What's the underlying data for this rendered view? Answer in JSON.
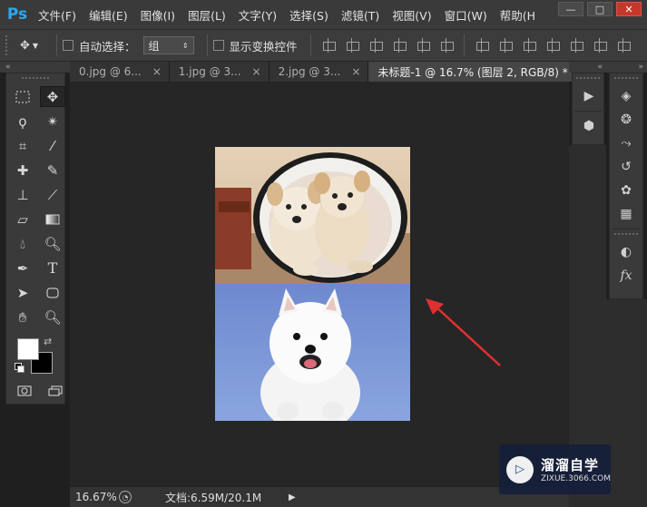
{
  "app": {
    "logo": "Ps"
  },
  "menu": [
    "文件(F)",
    "编辑(E)",
    "图像(I)",
    "图层(L)",
    "文字(Y)",
    "选择(S)",
    "滤镜(T)",
    "视图(V)",
    "窗口(W)",
    "帮助(H"
  ],
  "window_controls": {
    "minimize": "—",
    "maximize": "□",
    "close": "✕"
  },
  "options": {
    "auto_select_label": "自动选择：",
    "auto_select_value": "组",
    "show_transform_label": "显示变换控件"
  },
  "tabs": [
    {
      "label": "0.jpg @ 6...",
      "close": "×"
    },
    {
      "label": "1.jpg @ 3...",
      "close": "×"
    },
    {
      "label": "2.jpg @ 3...",
      "close": "×"
    },
    {
      "label": "未标题-1 @ 16.7% (图层 2, RGB/8) *",
      "close": "×"
    }
  ],
  "colors": {
    "foreground": "#ffffff",
    "background": "#000000",
    "accent_logo": "#2da8f0",
    "arrow": "#e03030"
  },
  "status": {
    "zoom": "16.67%",
    "doc_size": "文档:6.59M/20.1M"
  },
  "watermark": {
    "logo_text": "▷",
    "title": "溜溜自学",
    "url": "ZIXUE.3066.COM"
  }
}
